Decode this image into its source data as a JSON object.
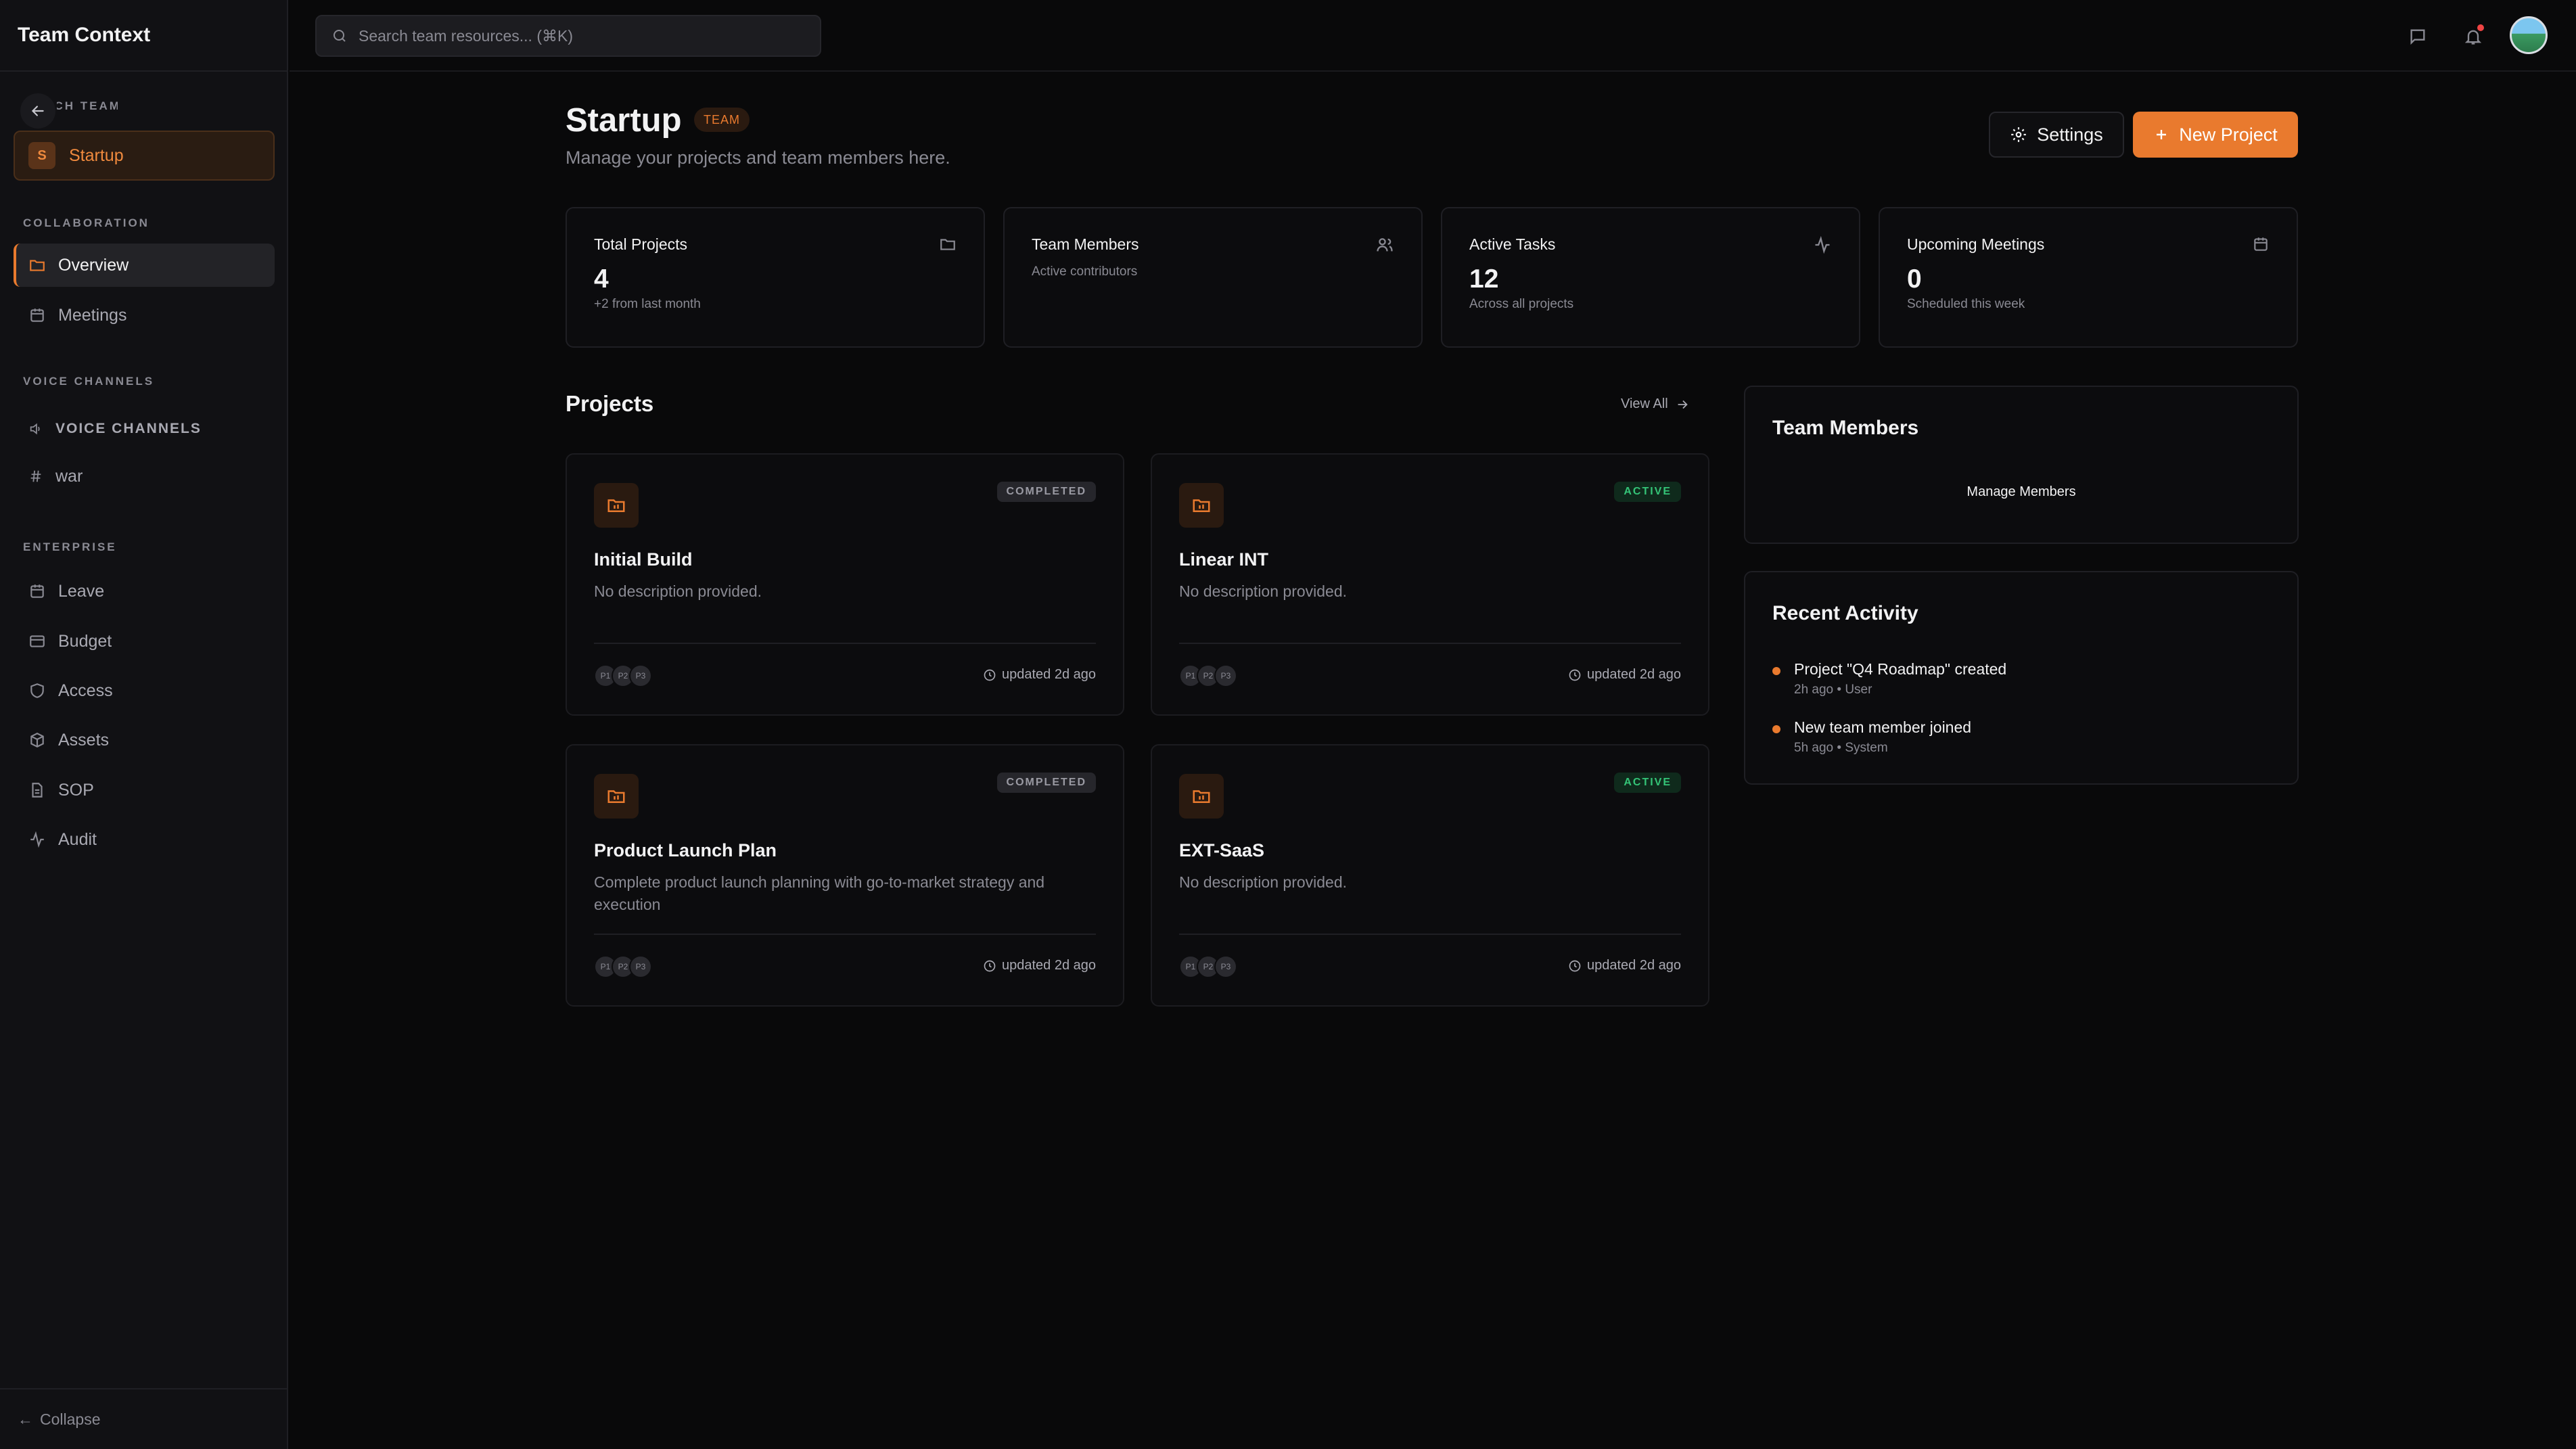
{
  "app": {
    "brand": "Team Context"
  },
  "sidebar": {
    "switch_label": "SWITCH TEAM",
    "team": {
      "initial": "S",
      "name": "Startup"
    },
    "sections": {
      "collaboration": "COLLABORATION",
      "voice": "VOICE CHANNELS",
      "enterprise": "ENTERPRISE"
    },
    "collab_items": [
      {
        "label": "Overview",
        "icon": "folder-icon"
      },
      {
        "label": "Meetings",
        "icon": "calendar-icon"
      }
    ],
    "voice_header": "VOICE CHANNELS",
    "voice_channels": [
      {
        "label": "war",
        "icon": "hash-icon"
      }
    ],
    "enterprise_items": [
      {
        "label": "Leave",
        "icon": "calendar-icon"
      },
      {
        "label": "Budget",
        "icon": "credit-card-icon"
      },
      {
        "label": "Access",
        "icon": "shield-icon"
      },
      {
        "label": "Assets",
        "icon": "box-icon"
      },
      {
        "label": "SOP",
        "icon": "file-icon"
      },
      {
        "label": "Audit",
        "icon": "activity-icon"
      }
    ],
    "collapse_label": "Collapse"
  },
  "topbar": {
    "search_placeholder": "Search team resources... (⌘K)"
  },
  "header": {
    "title": "Startup",
    "badge": "TEAM",
    "subtitle": "Manage your projects and team members here.",
    "settings_label": "Settings",
    "new_project_label": "New Project"
  },
  "stats": [
    {
      "label": "Total Projects",
      "value": "4",
      "desc": "+2 from last month",
      "icon": "folder-icon"
    },
    {
      "label": "Team Members",
      "value": "",
      "desc": "Active contributors",
      "icon": "users-icon"
    },
    {
      "label": "Active Tasks",
      "value": "12",
      "desc": "Across all projects",
      "icon": "activity-icon"
    },
    {
      "label": "Upcoming Meetings",
      "value": "0",
      "desc": "Scheduled this week",
      "icon": "calendar-icon"
    }
  ],
  "projects": {
    "title": "Projects",
    "view_all": "View All",
    "items": [
      {
        "title": "Initial Build",
        "status": "COMPLETED",
        "desc": "No description provided.",
        "avatars": [
          "P1",
          "P2",
          "P3"
        ],
        "updated": "updated 2d ago"
      },
      {
        "title": "Linear INT",
        "status": "ACTIVE",
        "desc": "No description provided.",
        "avatars": [
          "P1",
          "P2",
          "P3"
        ],
        "updated": "updated 2d ago"
      },
      {
        "title": "Product Launch Plan",
        "status": "COMPLETED",
        "desc": "Complete product launch planning with go-to-market strategy and execution",
        "avatars": [
          "P1",
          "P2",
          "P3"
        ],
        "updated": "updated 2d ago"
      },
      {
        "title": "EXT-SaaS",
        "status": "ACTIVE",
        "desc": "No description provided.",
        "avatars": [
          "P1",
          "P2",
          "P3"
        ],
        "updated": "updated 2d ago"
      }
    ]
  },
  "team_members_card": {
    "title": "Team Members",
    "manage_label": "Manage Members"
  },
  "recent_activity": {
    "title": "Recent Activity",
    "items": [
      {
        "text": "Project \"Q4 Roadmap\" created",
        "meta": "2h ago • User"
      },
      {
        "text": "New team member joined",
        "meta": "5h ago • System"
      }
    ]
  },
  "colors": {
    "accent": "#e97a2e",
    "active_status": "#34c477",
    "background": "#09090a"
  }
}
